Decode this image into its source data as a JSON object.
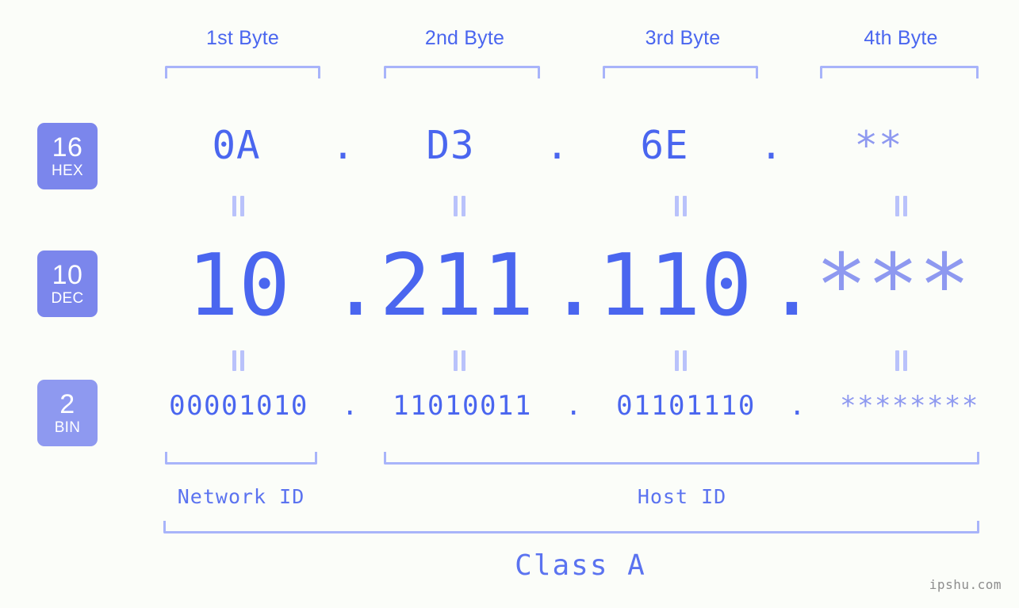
{
  "meta": {
    "background_color": "#fbfdf9",
    "accent_color": "#4a66ef",
    "bracket_color": "#a8b4fa",
    "badge_color": "#7b86ec",
    "masked_color": "#8e99f0",
    "watermark": "ipshu.com"
  },
  "byte_headers": [
    {
      "label": "1st Byte"
    },
    {
      "label": "2nd Byte"
    },
    {
      "label": "3rd Byte"
    },
    {
      "label": "4th Byte"
    }
  ],
  "bases": [
    {
      "num": "16",
      "name": "HEX"
    },
    {
      "num": "10",
      "name": "DEC"
    },
    {
      "num": "2",
      "name": "BIN"
    }
  ],
  "rows": {
    "hex": {
      "base_num": "16",
      "base_name": "HEX",
      "values": [
        "0A",
        "D3",
        "6E",
        "**"
      ],
      "separators": [
        ".",
        ".",
        "."
      ]
    },
    "dec": {
      "base_num": "10",
      "base_name": "DEC",
      "values": [
        "10",
        "211",
        "110",
        "***"
      ],
      "separators": [
        ".",
        ".",
        "."
      ]
    },
    "bin": {
      "base_num": "2",
      "base_name": "BIN",
      "values": [
        "00001010",
        "11010011",
        "01101110",
        "********"
      ],
      "separators": [
        ".",
        ".",
        "."
      ]
    }
  },
  "equality_symbol": "=",
  "segments": {
    "network_id": "Network ID",
    "host_id": "Host ID",
    "class": "Class A"
  },
  "ip_info": {
    "address_decimal": "10.211.110.***",
    "address_hex": "0A.D3.6E.**",
    "address_binary": "00001010.11010011.01101110.********",
    "class": "Class A",
    "network_id_bytes": 1,
    "host_id_bytes": 3,
    "masked_byte_index": 4
  }
}
